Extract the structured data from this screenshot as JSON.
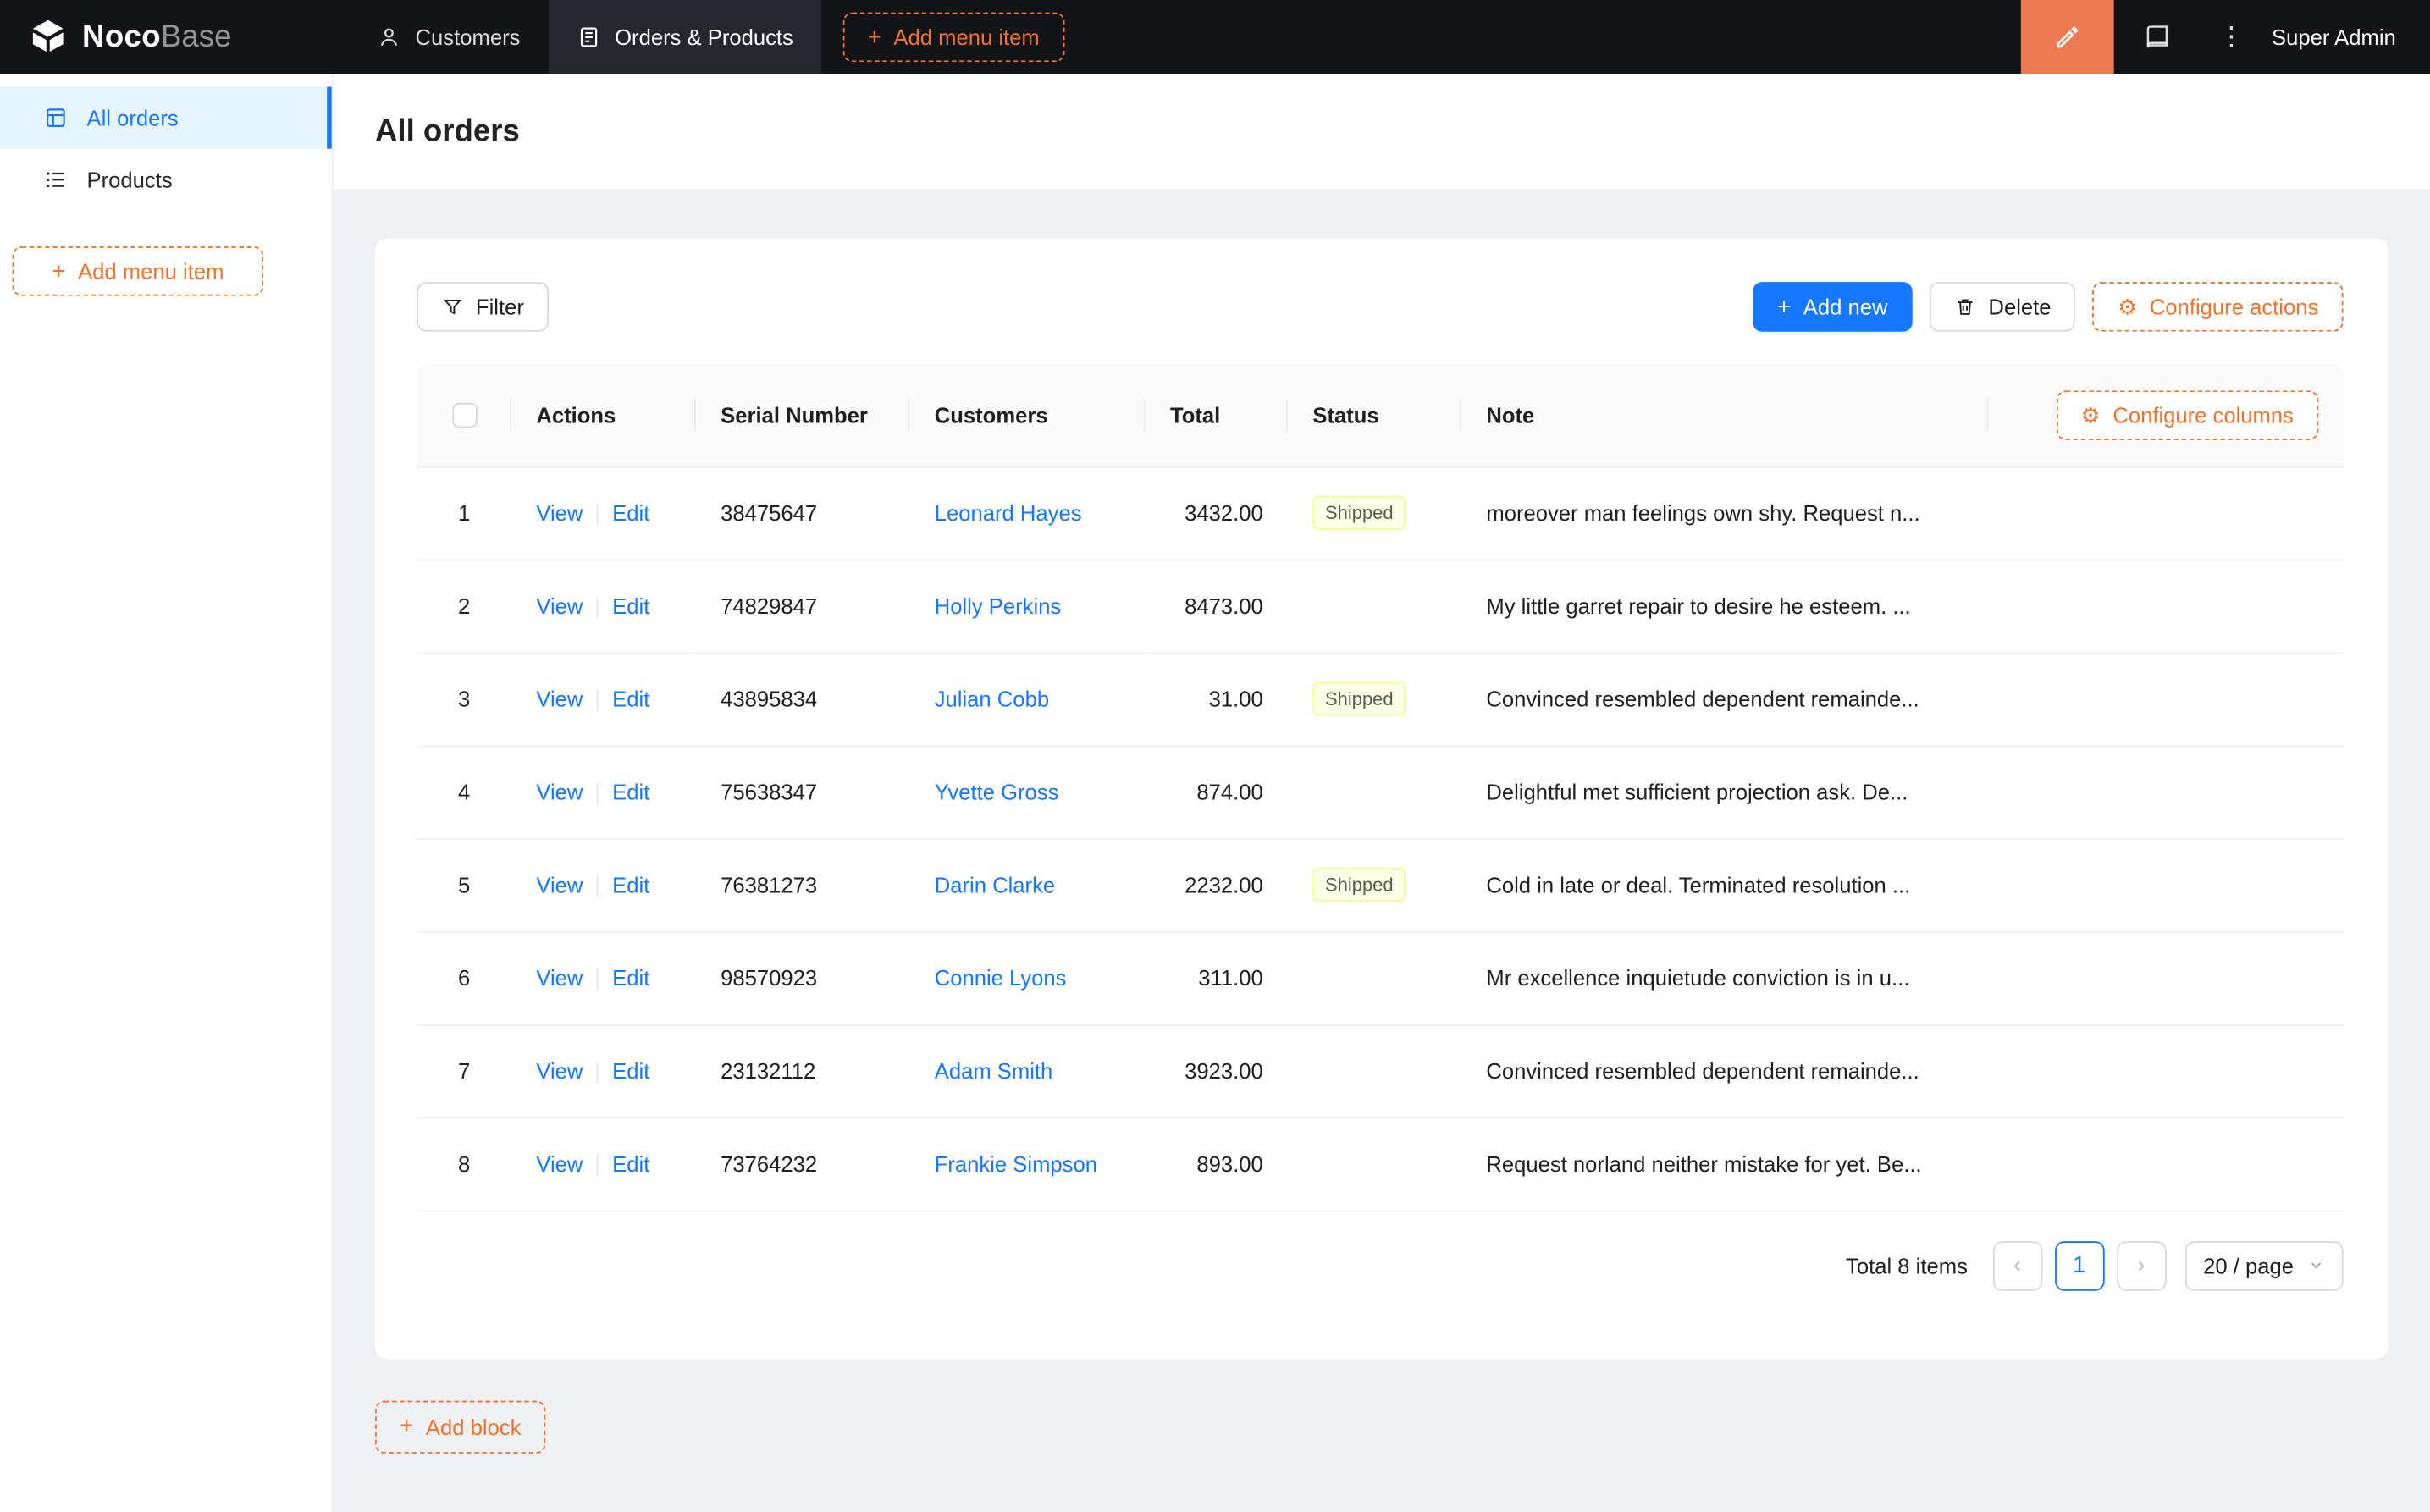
{
  "colors": {
    "accent_orange": "#F5722D",
    "designer_button_orange": "#ED7B52",
    "primary_blue": "#1677FF",
    "header_bg": "#121418",
    "sidebar_active_bg": "#E6F4FF",
    "status_shipped_bg": "#FCFFE6",
    "status_shipped_border": "#EAFF8F"
  },
  "icons": {
    "plus": "+",
    "more": "⋮",
    "gear": "⚙",
    "prev": "‹",
    "next": "›"
  },
  "header": {
    "brand": {
      "noco": "Noco",
      "base": "Base"
    },
    "nav": [
      {
        "label": "Customers"
      },
      {
        "label": "Orders & Products"
      }
    ],
    "add_menu_item": "Add menu item",
    "user": "Super Admin"
  },
  "sidebar": {
    "items": [
      {
        "label": "All orders"
      },
      {
        "label": "Products"
      }
    ],
    "add_menu_item": "Add menu item"
  },
  "page": {
    "title": "All orders"
  },
  "toolbar": {
    "filter": "Filter",
    "add_new": "Add new",
    "delete": "Delete",
    "configure_actions": "Configure actions",
    "configure_columns": "Configure columns"
  },
  "table": {
    "columns": [
      "Actions",
      "Serial Number",
      "Customers",
      "Total",
      "Status",
      "Note"
    ],
    "actions": {
      "view": "View",
      "edit": "Edit"
    },
    "rows": [
      {
        "index": 1,
        "serial": "38475647",
        "customer": "Leonard Hayes",
        "total": "3432.00",
        "status": "Shipped",
        "note": "moreover man feelings own shy. Request n..."
      },
      {
        "index": 2,
        "serial": "74829847",
        "customer": "Holly Perkins",
        "total": "8473.00",
        "status": "",
        "note": "My little garret repair to desire he esteem. ..."
      },
      {
        "index": 3,
        "serial": "43895834",
        "customer": "Julian Cobb",
        "total": "31.00",
        "status": "Shipped",
        "note": "Convinced resembled dependent remainde..."
      },
      {
        "index": 4,
        "serial": "75638347",
        "customer": "Yvette Gross",
        "total": "874.00",
        "status": "",
        "note": "Delightful met sufficient projection ask. De..."
      },
      {
        "index": 5,
        "serial": "76381273",
        "customer": "Darin Clarke",
        "total": "2232.00",
        "status": "Shipped",
        "note": "Cold in late or deal. Terminated resolution ..."
      },
      {
        "index": 6,
        "serial": "98570923",
        "customer": "Connie Lyons",
        "total": "311.00",
        "status": "",
        "note": "Mr excellence inquietude conviction is in u..."
      },
      {
        "index": 7,
        "serial": "23132112",
        "customer": "Adam Smith",
        "total": "3923.00",
        "status": "",
        "note": "Convinced resembled dependent remainde..."
      },
      {
        "index": 8,
        "serial": "73764232",
        "customer": "Frankie Simpson",
        "total": "893.00",
        "status": "",
        "note": "Request norland neither mistake for yet. Be..."
      }
    ]
  },
  "pagination": {
    "total": "Total 8 items",
    "page": "1",
    "page_size": "20 / page"
  },
  "add_block": "Add block"
}
